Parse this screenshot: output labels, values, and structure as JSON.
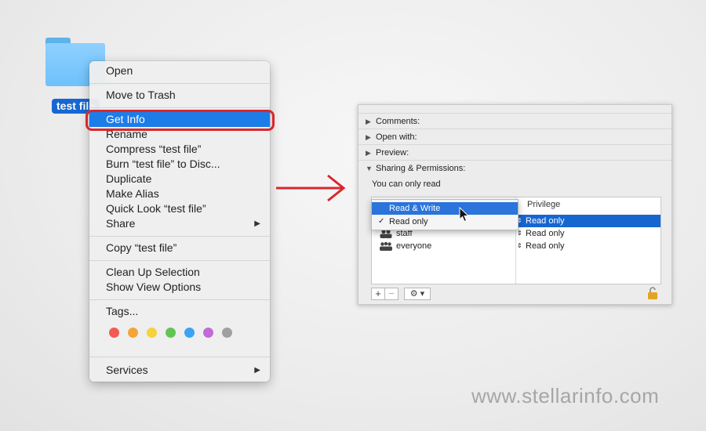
{
  "desktop": {
    "folder_label": "test file"
  },
  "context_menu": {
    "items": {
      "open": "Open",
      "move_to_trash": "Move to Trash",
      "get_info": "Get Info",
      "rename": "Rename",
      "compress": "Compress “test file”",
      "burn": "Burn “test file” to Disc...",
      "duplicate": "Duplicate",
      "make_alias": "Make Alias",
      "quick_look": "Quick Look “test file”",
      "share": "Share",
      "copy": "Copy “test file”",
      "clean_up": "Clean Up Selection",
      "show_view_options": "Show View Options",
      "tags": "Tags...",
      "services": "Services"
    },
    "submenu_arrow": "▶",
    "tag_colors": [
      "#f25a52",
      "#f5a43a",
      "#f4d33b",
      "#62c553",
      "#3aa4f3",
      "#c16ad8",
      "#a0a0a0"
    ]
  },
  "info_panel": {
    "sections": {
      "comments": "Comments:",
      "open_with": "Open with:",
      "preview": "Preview:",
      "sharing": "Sharing & Permissions:"
    },
    "read_note": "You can only read",
    "privilege_header": "Privilege",
    "popup": {
      "read_write": "Read & Write",
      "read_only": "Read only",
      "check": "✓"
    },
    "rows": [
      {
        "name": "",
        "privilege": "Read only"
      },
      {
        "name": "staff",
        "privilege": "Read only"
      },
      {
        "name": "everyone",
        "privilege": "Read only"
      }
    ],
    "add_button": "+",
    "remove_button": "−",
    "action_button": "⚙ ▾"
  },
  "watermark": "www.stellarinfo.com"
}
